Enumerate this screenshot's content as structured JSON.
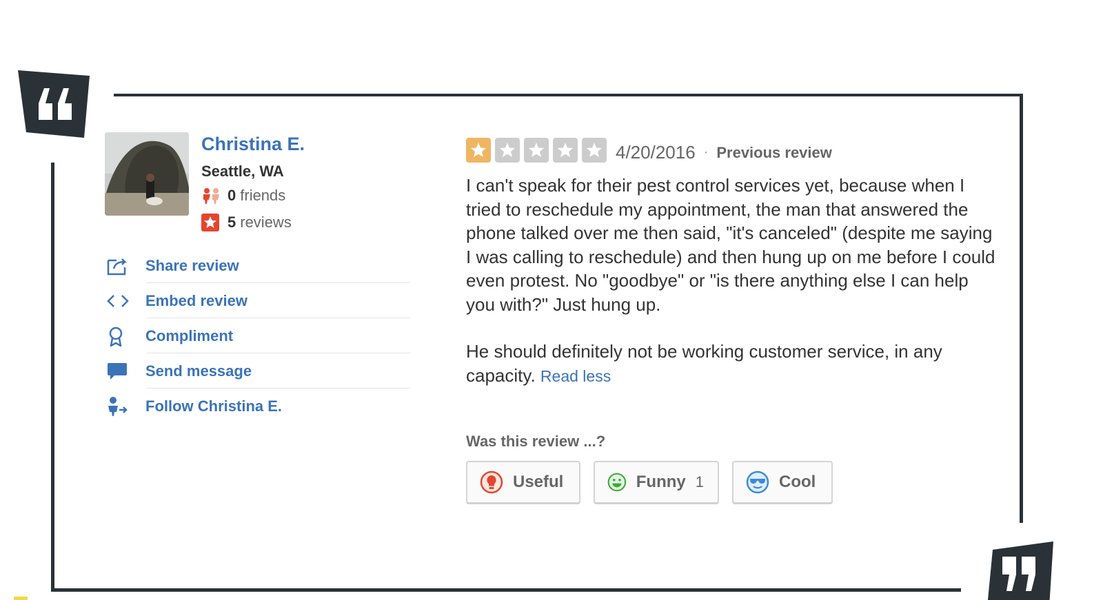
{
  "user": {
    "name": "Christina E.",
    "location": "Seattle, WA",
    "friends_count": "0",
    "friends_label": "friends",
    "reviews_count": "5",
    "reviews_label": "reviews"
  },
  "actions": [
    {
      "label": "Share review",
      "icon": "share-icon"
    },
    {
      "label": "Embed review",
      "icon": "embed-code-icon"
    },
    {
      "label": "Compliment",
      "icon": "award-ribbon-icon"
    },
    {
      "label": "Send message",
      "icon": "speech-bubble-icon"
    },
    {
      "label": "Follow Christina E.",
      "icon": "follow-person-icon"
    }
  ],
  "review": {
    "rating": 1,
    "rating_max": 5,
    "date": "4/20/2016",
    "separator": "·",
    "previous_review_label": "Previous review",
    "paragraphs": [
      "I can't speak for their pest control services yet, because when I tried to reschedule my appointment, the man that answered the phone talked over me then said, \"it's canceled\" (despite me saying I was calling to reschedule) and then hung up on me before I could even protest. No \"goodbye\" or \"is there anything else I can help you with?\" Just hung up.",
      "He should definitely not be working customer service, in any capacity."
    ],
    "read_less_label": "Read less"
  },
  "voting": {
    "question": "Was this review ...?",
    "useful_label": "Useful",
    "funny_label": "Funny",
    "funny_count": "1",
    "cool_label": "Cool"
  },
  "colors": {
    "link_blue": "#3b73b9",
    "star_filled": "#f0b562",
    "star_empty": "#cccccc",
    "frame_dark": "#2a3238",
    "yelp_red": "#e5452f",
    "funny_green": "#3aaa35",
    "cool_blue": "#3a8bd8"
  }
}
